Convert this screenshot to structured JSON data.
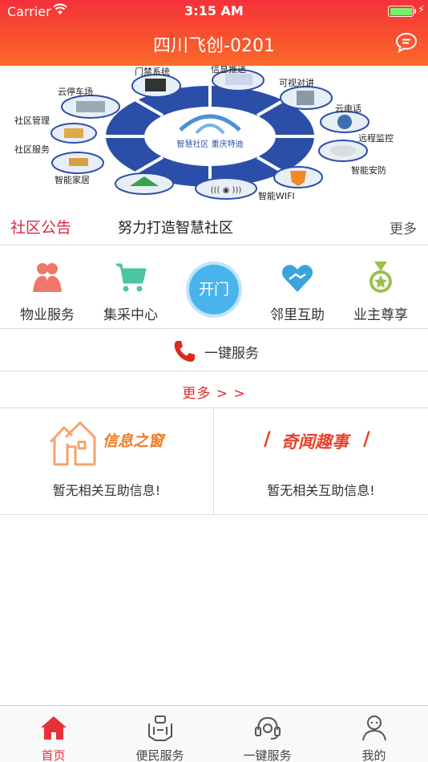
{
  "status_bar": {
    "carrier": "Carrier",
    "time": "3:15 AM",
    "battery_level": 1.0
  },
  "nav": {
    "title": "四川飞创-0201"
  },
  "banner": {
    "center_brand": "智慧社区  重庆特迪",
    "labels": [
      "门禁系统",
      "信息推送",
      "可视对讲",
      "云电话",
      "远程监控",
      "智能安防",
      "智能WIFI",
      "智能家居",
      "社区服务",
      "社区管理",
      "云停车场"
    ]
  },
  "notice": {
    "label": "社区公告",
    "text": "努力打造智慧社区",
    "more": "更多"
  },
  "quick": {
    "items": [
      {
        "label": "物业服务",
        "icon": "people-icon"
      },
      {
        "label": "集采中心",
        "icon": "cart-icon"
      },
      {
        "label": "邻里互助",
        "icon": "handshake-heart-icon"
      },
      {
        "label": "业主尊享",
        "icon": "medal-icon"
      }
    ],
    "open_door": "开门"
  },
  "one_key": {
    "label": "一键服务"
  },
  "more_link": "更多 > >",
  "panels": {
    "left": {
      "title": "信息之窗",
      "empty": "暂无相关互助信息!"
    },
    "right": {
      "title": "奇闻趣事",
      "empty": "暂无相关互助信息!"
    }
  },
  "tabbar": {
    "tabs": [
      {
        "label": "首页",
        "icon": "home-icon",
        "active": true
      },
      {
        "label": "便民服务",
        "icon": "service-icon",
        "active": false
      },
      {
        "label": "一键服务",
        "icon": "headset-icon",
        "active": false
      },
      {
        "label": "我的",
        "icon": "user-icon",
        "active": false
      }
    ]
  },
  "colors": {
    "header": "#f5303a",
    "accent_red": "#d9283c",
    "open_button": "#4ab3ec",
    "active_tab": "#e8303a"
  }
}
